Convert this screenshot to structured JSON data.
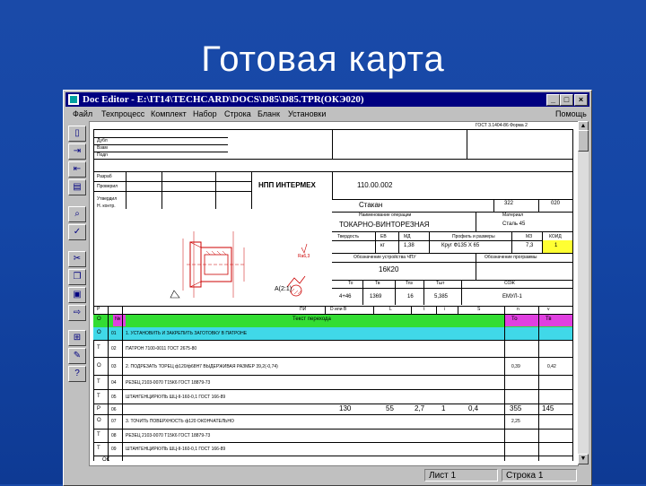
{
  "slide": {
    "title": "Готовая карта"
  },
  "window": {
    "title": "Doc Editor - E:\\IT14\\TECHCARD\\DOCS\\D85\\D85.TPR(ОКЭ020)",
    "buttons": {
      "minimize": "_",
      "maximize": "□",
      "close": "×"
    }
  },
  "menu": {
    "items": [
      "Файл",
      "Техпроцесс",
      "Комплект",
      "Набор",
      "Строка",
      "Бланк",
      "Установки"
    ],
    "help": "Помощь"
  },
  "doc": {
    "gost": "ГОСТ 3.1404-86  Форма 2",
    "side_labels": [
      "Дубл",
      "Взам",
      "Подп"
    ],
    "sign_labels": [
      "Разраб",
      "Проверил",
      "Утвердил",
      "Н. контр."
    ],
    "org": "НПП ИНТЕРМЕХ",
    "drawing_no": "110.00.002",
    "part": "Стакан",
    "part_code": "322",
    "part_code2": "020",
    "label_name": "Наименование операции",
    "label_material": "Материал",
    "operation": "ТОКАРНО-ВИНТОРЕЗНАЯ",
    "material": "Сталь 45",
    "props_headers": [
      "Твердость",
      "ЕВ",
      "МД",
      "Профиль и размеры",
      "МЗ",
      "КОИД"
    ],
    "props_values": [
      "",
      "кг",
      "1,38",
      "Круг Ф135 Х 65",
      "7,3",
      "1"
    ],
    "equipment_label": "Обозначение устройства ЧПУ",
    "program_label": "Обозначение программы",
    "machine": "16К20",
    "sketch_label": "А(2:1)",
    "roughness": "Ra6,3",
    "times_headers": [
      "То",
      "Тв",
      "Тпз",
      "Тшт",
      "СОЖ"
    ],
    "times_values": [
      "4+46",
      "1369",
      "16",
      "5,385",
      "ЕМУЛ-1"
    ],
    "col_headers": [
      "Р",
      "ПИ",
      "D или В",
      "L",
      "t",
      "i",
      "S",
      "n",
      "v"
    ],
    "table_header": {
      "o": "О",
      "num": "№",
      "text": "Текст перехода",
      "to": "То",
      "tv": "Тв"
    },
    "rows": [
      {
        "kind": "О",
        "n": "01",
        "text": "1.   УСТАНОВИТЬ И ЗАКРЕПИТЬ ЗАГОТОВКУ В ПАТРОНЕ",
        "to": "",
        "tv": ""
      },
      {
        "kind": "Т",
        "n": "02",
        "text": "ПАТРОН 7100-0011 ГОСТ 2675-80",
        "to": "",
        "tv": ""
      },
      {
        "kind": "О",
        "n": "03",
        "text": "2.   ПОДРЕЗАТЬ ТОРЕЦ ф120/ф68Н7 ВЫДЕРЖИВАЯ РАЗМЕР 39,2(-0,74)",
        "to": "0,39",
        "tv": "0,42"
      },
      {
        "kind": "Т",
        "n": "04",
        "text": "РЕЗЕЦ 2103-0070 Т15К6 ГОСТ 18879-73",
        "to": "",
        "tv": ""
      },
      {
        "kind": "Т",
        "n": "05",
        "text": "ШТАНГЕНЦИРКУЛЬ ШЦ-II-160-0,1 ГОСТ 166-89",
        "to": "",
        "tv": ""
      },
      {
        "kind": "Р",
        "n": "06",
        "d": "130",
        "l": "55",
        "t": "2,7",
        "i": "1",
        "s": "0,4",
        "nn": "355",
        "v": "145"
      },
      {
        "kind": "О",
        "n": "07",
        "text": "3.   ТОЧИТЬ ПОВЕРХНОСТЬ ф120 ОКОНЧАТЕЛЬНО",
        "to": "2,25",
        "tv": ""
      },
      {
        "kind": "Т",
        "n": "08",
        "text": "РЕЗЕЦ 2103-0070 Т15К6 ГОСТ 18879-73",
        "to": "",
        "tv": ""
      },
      {
        "kind": "Т",
        "n": "09",
        "text": "ШТАНГЕНЦИРКУЛЬ ШЦ-II-160-0,1 ГОСТ 166-89",
        "to": "",
        "tv": ""
      }
    ],
    "footer_label": "ОК"
  },
  "status": {
    "sheet": "Лист 1",
    "line": "Строка 1"
  },
  "colors": {
    "slide_bg": "#1446a6",
    "titlebar": "#000080",
    "green": "#33dd33",
    "magenta": "#e040e0",
    "cyan": "#40d8e8",
    "yellow": "#ffff33"
  }
}
